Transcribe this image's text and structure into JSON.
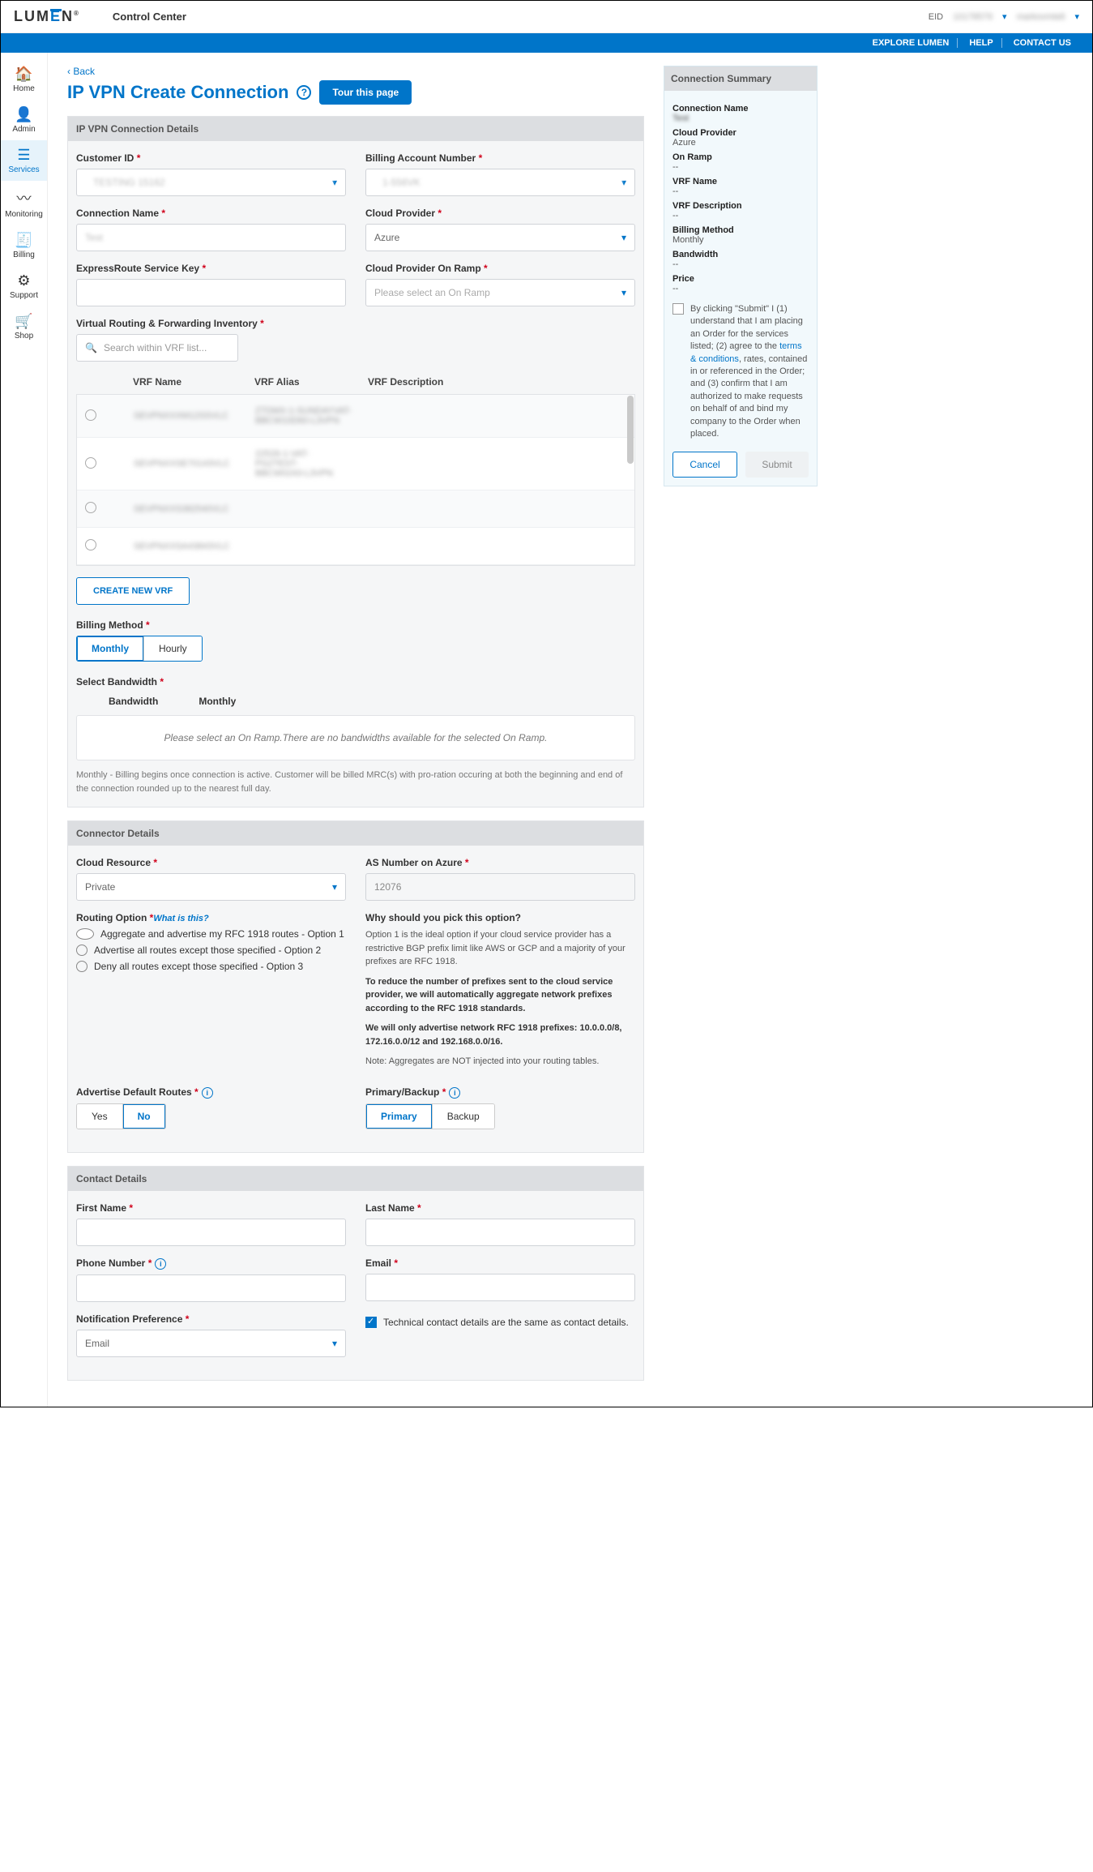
{
  "header": {
    "brand1": "LUM",
    "brand2": "E",
    "brand3": "N",
    "cc": "Control Center",
    "eid": "EID",
    "eidnum": "10178579",
    "user": "markovmtelt"
  },
  "bluebar": {
    "explore": "EXPLORE LUMEN",
    "help": "HELP",
    "contact": "CONTACT US"
  },
  "side": {
    "home": "Home",
    "admin": "Admin",
    "services": "Services",
    "monitoring": "Monitoring",
    "billing": "Billing",
    "support": "Support",
    "shop": "Shop"
  },
  "page": {
    "back": "Back",
    "title": "IP VPN Create Connection",
    "tour": "Tour this page"
  },
  "sec1": {
    "title": "IP VPN Connection Details",
    "cust": "Customer ID",
    "ban": "Billing Account Number",
    "conn": "Connection Name",
    "cloud": "Cloud Provider",
    "erk": "ExpressRoute Service Key",
    "onramp": "Cloud Provider On Ramp",
    "onramp_ph": "Please select an On Ramp",
    "custval": "TESTING 15162",
    "banval": "1-556VK",
    "connval": "Test",
    "cloudval": "Azure",
    "vrf": "Virtual Routing & Forwarding Inventory",
    "search_ph": "Search within VRF list...",
    "th": {
      "name": "VRF Name",
      "alias": "VRF Alias",
      "desc": "VRF Description"
    },
    "rows": [
      {
        "n": "SEVPNXXXM12SSVLC",
        "a": "ZTDMX-1-SUNDAYVAT-\nBBCW10D60-L3VPN"
      },
      {
        "n": "SEVPNXXSE70143VLC",
        "a": "22526-1-VAT-\nPG2TEST-\nBBCW0243-L3VPN"
      },
      {
        "n": "SEVPNXXS382540VLC",
        "a": ""
      },
      {
        "n": "SEVPNXXSA43843VLC",
        "a": ""
      }
    ],
    "newvrf": "CREATE NEW VRF",
    "bm": "Billing Method",
    "monthly": "Monthly",
    "hourly": "Hourly",
    "selbw": "Select Bandwidth",
    "bw": "Bandwidth",
    "bwm": "Monthly",
    "bwmsg": "Please select an On Ramp.There are no bandwidths available for the selected On Ramp.",
    "note": "Monthly - Billing begins once connection is active. Customer will be billed MRC(s) with pro-ration occuring at both the beginning and end of the connection rounded up to the nearest full day."
  },
  "sec2": {
    "title": "Connector Details",
    "cres": "Cloud Resource",
    "cresval": "Private",
    "asn": "AS Number on Azure",
    "asnval": "12076",
    "ropt": "Routing Option",
    "what": "What is this?",
    "opt1": "Aggregate and advertise my RFC 1918 routes - Option 1",
    "opt2": "Advertise all routes except those specified - Option 2",
    "opt3": "Deny all routes except those specified - Option 3",
    "why": "Why should you pick this option?",
    "p1": "Option 1 is the ideal option if your cloud service provider has a restrictive BGP prefix limit like AWS or GCP and a majority of your prefixes are RFC 1918.",
    "p2": "To reduce the number of prefixes sent to the cloud service provider, we will automatically aggregate network prefixes according to the RFC 1918 standards.",
    "p3": "We will only advertise network RFC 1918 prefixes: 10.0.0.0/8, 172.16.0.0/12 and 192.168.0.0/16.",
    "p4": "Note: Aggregates are NOT injected into your routing tables.",
    "adr": "Advertise Default Routes",
    "yes": "Yes",
    "no": "No",
    "pb": "Primary/Backup",
    "primary": "Primary",
    "backup": "Backup"
  },
  "sec3": {
    "title": "Contact Details",
    "fn": "First Name",
    "ln": "Last Name",
    "ph": "Phone Number",
    "em": "Email",
    "np": "Notification Preference",
    "npval": "Email",
    "same": "Technical contact details are the same as contact details."
  },
  "summary": {
    "title": "Connection Summary",
    "cn": "Connection Name",
    "cnv": "Test",
    "cp": "Cloud Provider",
    "cpv": "Azure",
    "or": "On Ramp",
    "orv": "--",
    "vn": "VRF Name",
    "vnv": "--",
    "vd": "VRF Description",
    "vdv": "--",
    "bm": "Billing Method",
    "bmv": "Monthly",
    "bw": "Bandwidth",
    "bwv": "--",
    "pr": "Price",
    "prv": "--",
    "legal1": "By clicking \"Submit\" I (1) understand that I am placing an Order for the services listed; (2) agree to the ",
    "terms": "terms & conditions",
    "legal2": ", rates, contained in or referenced in the Order; and (3) confirm that I am authorized to make requests on behalf of and bind my company to the Order when placed.",
    "cancel": "Cancel",
    "submit": "Submit"
  }
}
